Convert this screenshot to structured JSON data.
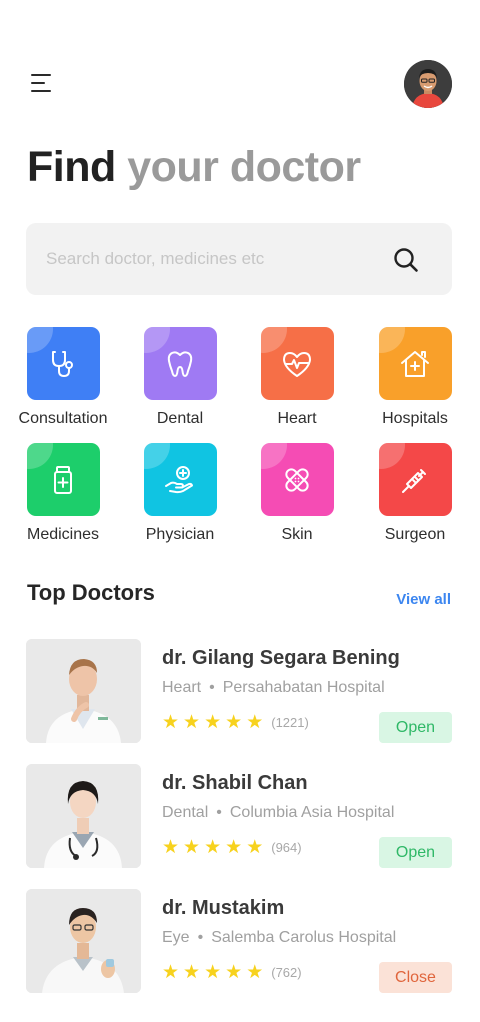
{
  "header": {
    "menu_icon": "hamburger-menu-icon",
    "avatar": "user-avatar"
  },
  "title": {
    "part1": "Find",
    "part2": "your doctor"
  },
  "search": {
    "placeholder": "Search doctor, medicines etc",
    "icon": "search-icon"
  },
  "categories": [
    {
      "label": "Consultation",
      "icon": "stethoscope-icon",
      "color": "#3f7ff5"
    },
    {
      "label": "Dental",
      "icon": "tooth-icon",
      "color": "#9f7af3"
    },
    {
      "label": "Heart",
      "icon": "heart-pulse-icon",
      "color": "#f66f47"
    },
    {
      "label": "Hospitals",
      "icon": "hospital-icon",
      "color": "#f9a02a"
    },
    {
      "label": "Medicines",
      "icon": "medicine-bottle-icon",
      "color": "#1dce6b"
    },
    {
      "label": "Physician",
      "icon": "hand-care-icon",
      "color": "#10c4e2"
    },
    {
      "label": "Skin",
      "icon": "bandage-icon",
      "color": "#f54cb4"
    },
    {
      "label": "Surgeon",
      "icon": "syringe-icon",
      "color": "#f44848"
    }
  ],
  "top_doctors": {
    "title": "Top Doctors",
    "view_all": "View all",
    "doctors": [
      {
        "name": "dr. Gilang Segara Bening",
        "specialty": "Heart",
        "hospital": "Persahabatan Hospital",
        "rating_count": "(1221)",
        "stars": 5,
        "status": "Open"
      },
      {
        "name": "dr. Shabil Chan",
        "specialty": "Dental",
        "hospital": "Columbia Asia Hospital",
        "rating_count": "(964)",
        "stars": 5,
        "status": "Open"
      },
      {
        "name": "dr. Mustakim",
        "specialty": "Eye",
        "hospital": "Salemba Carolus Hospital",
        "rating_count": "(762)",
        "stars": 5,
        "status": "Close"
      }
    ],
    "dot": "•",
    "star_glyph": "★"
  },
  "colors": {
    "accent": "#3c86f0",
    "open_bg": "#d9f6e4",
    "open_text": "#2fb867",
    "close_bg": "#fbe2d7",
    "close_text": "#e0653c",
    "star": "#f7d21e"
  }
}
